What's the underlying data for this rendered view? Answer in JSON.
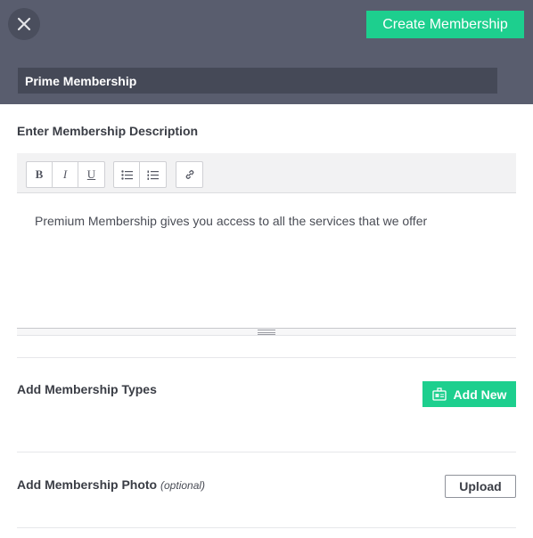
{
  "header": {
    "close_icon": "close-icon",
    "create_button_label": "Create Membership",
    "membership_name": "Prime Membership"
  },
  "description": {
    "label": "Enter Membership Description",
    "toolbar": {
      "bold": "B",
      "italic": "I",
      "underline": "U",
      "bullet_list_icon": "bullet-list-icon",
      "numbered_list_icon": "numbered-list-icon",
      "link_icon": "link-icon"
    },
    "text": "Premium Membership gives you access to all the services that we offer"
  },
  "types": {
    "label": "Add Membership Types",
    "add_new_label": "Add New",
    "add_new_icon": "add-membership-icon"
  },
  "photo": {
    "label": "Add Membership Photo",
    "optional_label": "(optional)",
    "upload_label": "Upload"
  },
  "colors": {
    "header_bg": "#595d6e",
    "accent": "#1dcf8e",
    "name_field_bg": "#454957"
  }
}
